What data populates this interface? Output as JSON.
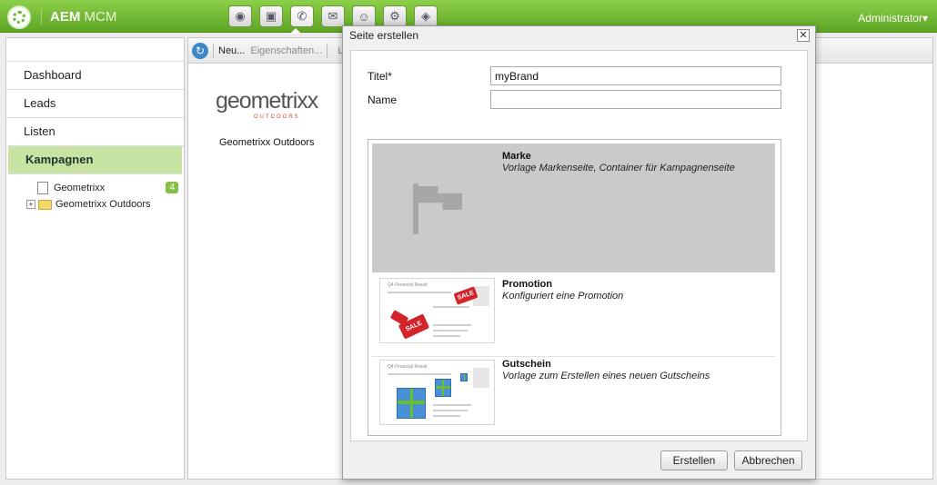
{
  "app": {
    "title_bold": "AEM",
    "title_light": "MCM",
    "user": "Administrator▾"
  },
  "nav_icons": [
    "globe-icon",
    "camera-icon",
    "megaphone-icon",
    "mail-icon",
    "users-icon",
    "gears-icon",
    "tag-icon"
  ],
  "sidebar": {
    "items": [
      {
        "label": "Dashboard"
      },
      {
        "label": "Leads"
      },
      {
        "label": "Listen"
      },
      {
        "label": "Kampagnen",
        "selected": true
      }
    ],
    "tree": [
      {
        "label": "Geometrixx",
        "badge": "4"
      },
      {
        "label": "Geometrixx Outdoors",
        "expander": "+"
      }
    ]
  },
  "toolbar": {
    "new_label": "Neu...",
    "properties_label": "Eigenschaften...",
    "truncated_label": "Lö"
  },
  "main": {
    "logo_word": "geometrixx",
    "logo_sub": "OUTDOORS",
    "brand_name": "Geometrixx Outdoors"
  },
  "dialog": {
    "title": "Seite erstellen",
    "close_glyph": "✕",
    "title_label": "Titel*",
    "title_value": "myBrand",
    "name_label": "Name",
    "name_value": "",
    "templates": [
      {
        "title": "Marke",
        "desc": "Vorlage Markenseite, Container für Kampagnenseite"
      },
      {
        "title": "Promotion",
        "desc": "Konfiguriert eine Promotion"
      },
      {
        "title": "Gutschein",
        "desc": "Vorlage zum Erstellen eines neuen Gutscheins"
      }
    ],
    "thumb_heading": "Q4 Financial Result",
    "sale_label": "SALE",
    "create_button": "Erstellen",
    "cancel_button": "Abbrechen"
  },
  "colors": {
    "topbar_green": "#6cb52e",
    "selected_nav": "#c7e4a3",
    "badge_green": "#85bf45",
    "selected_template": "#cacaca"
  }
}
